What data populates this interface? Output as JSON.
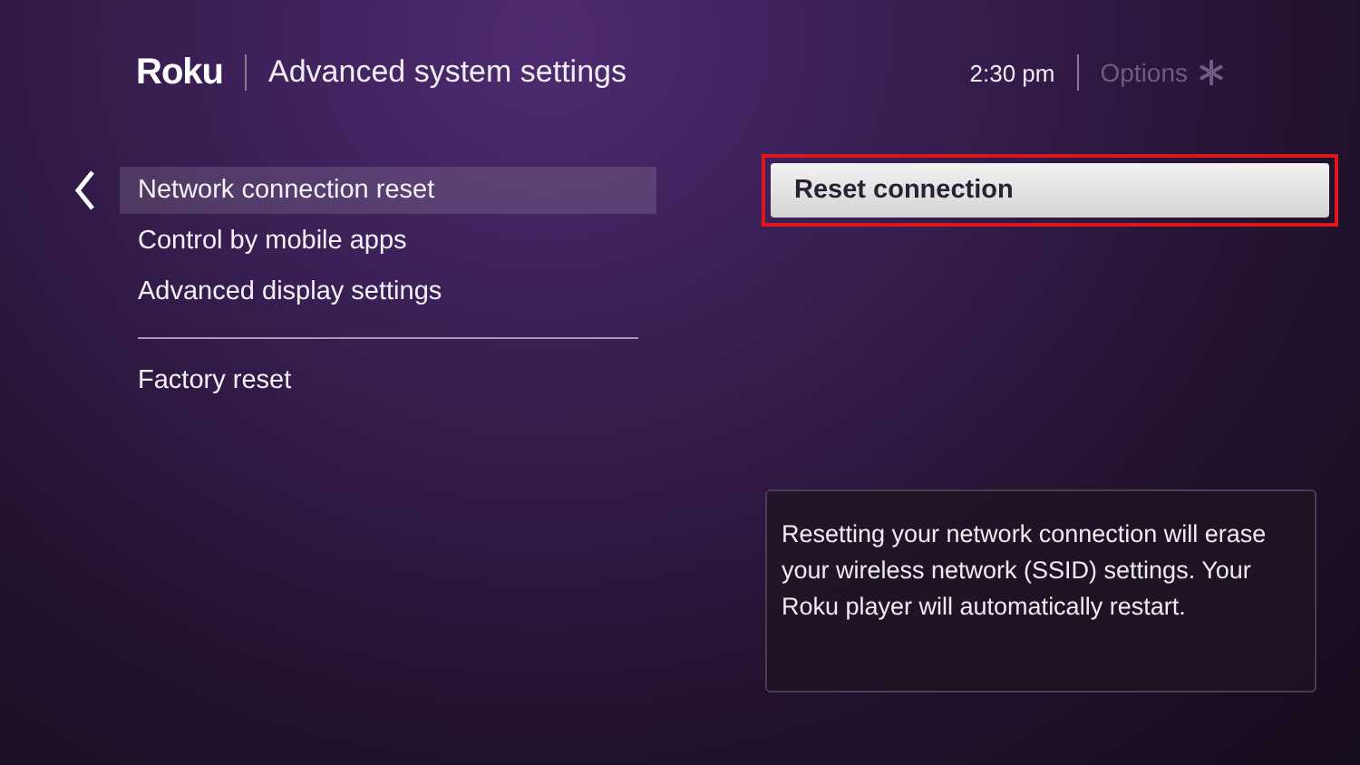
{
  "header": {
    "logo": "Roku",
    "title": "Advanced system settings",
    "time": "2:30 pm",
    "options": "Options"
  },
  "menu": {
    "groups": [
      [
        {
          "label": "Network connection reset",
          "selected": true
        },
        {
          "label": "Control by mobile apps",
          "selected": false
        },
        {
          "label": "Advanced display settings",
          "selected": false
        }
      ],
      [
        {
          "label": "Factory reset",
          "selected": false
        }
      ]
    ]
  },
  "action": {
    "label": "Reset connection",
    "highlighted": true
  },
  "info": "Resetting your network connection will erase your wireless network (SSID) settings. Your Roku player will automatically restart."
}
